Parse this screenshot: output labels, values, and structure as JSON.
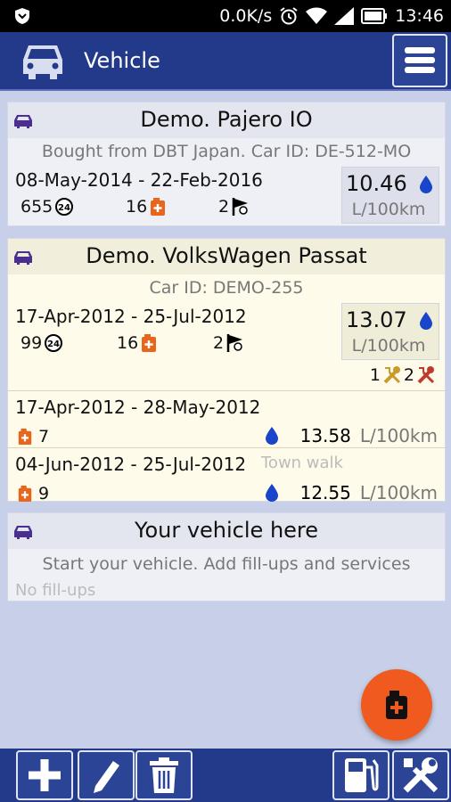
{
  "status": {
    "speed": "0.0K/s",
    "time": "13:46"
  },
  "appbar": {
    "title": "Vehicle"
  },
  "vehicles": [
    {
      "name": "Demo. Pajero IO",
      "note": "Bought from DBT Japan. Car ID: DE-512-MO",
      "dates": "08-May-2014 - 22-Feb-2016",
      "days": "655",
      "fillups": "16",
      "flags": "2",
      "consumption": "10.46",
      "unit": "L/100km"
    },
    {
      "name": "Demo. VolksWagen Passat",
      "note": "Car ID: DEMO-255",
      "dates": "17-Apr-2012 - 25-Jul-2012",
      "days": "99",
      "fillups": "16",
      "flags": "2",
      "consumption": "13.07",
      "unit": "L/100km",
      "services": "1",
      "repairs": "2",
      "periods": [
        {
          "dates": "17-Apr-2012 - 28-May-2012",
          "note": "",
          "fillups": "7",
          "consumption": "13.58",
          "unit": "L/100km"
        },
        {
          "dates": "04-Jun-2012 - 25-Jul-2012",
          "note": "Town walk",
          "fillups": "9",
          "consumption": "12.55",
          "unit": "L/100km"
        }
      ]
    },
    {
      "name": "Your vehicle here",
      "note": "Start your vehicle. Add fill-ups and services",
      "empty": "No fill-ups"
    }
  ],
  "icons": {
    "accent": "#233a8a",
    "fab": "#f05a1e",
    "fuel": "#e8661c",
    "drop": "#1845c9",
    "car": "#4b2f8f"
  }
}
